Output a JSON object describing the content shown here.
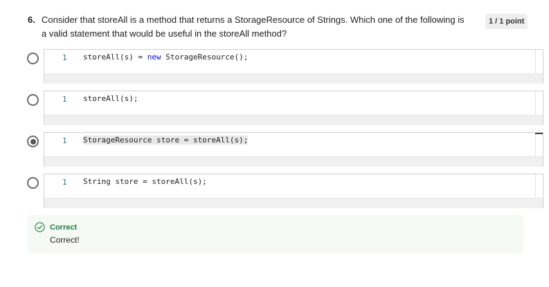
{
  "question": {
    "number": "6.",
    "text": "Consider that storeAll is a method that returns a StorageResource of Strings. Which one of the following is a valid statement that would be useful in the storeAll method?",
    "points": "1 / 1 point"
  },
  "options": [
    {
      "line": "1",
      "code_pre": "storeAll(s) = ",
      "code_kw": "new",
      "code_post": " StorageResource();",
      "selected": false
    },
    {
      "line": "1",
      "code": "storeAll(s);",
      "selected": false
    },
    {
      "line": "1",
      "code": "StorageResource store = storeAll(s);",
      "selected": true
    },
    {
      "line": "1",
      "code": "String store = storeAll(s);",
      "selected": false
    }
  ],
  "feedback": {
    "title": "Correct",
    "text": "Correct!"
  },
  "colors": {
    "correct_green": "#1e7d32",
    "keyword_blue": "#0000ff",
    "line_number": "#237893"
  }
}
